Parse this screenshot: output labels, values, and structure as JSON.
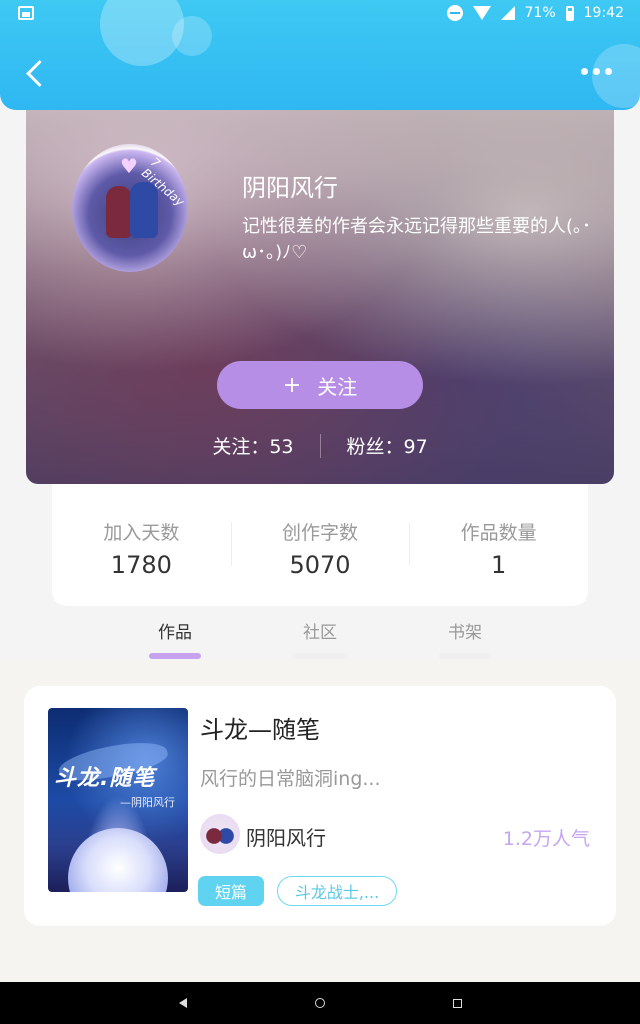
{
  "status_bar": {
    "battery": "71%",
    "time": "19:42"
  },
  "profile": {
    "name": "阴阳风行",
    "bio": "记性很差的作者会永远记得那些重要的人(｡･ω･｡)ﾉ♡",
    "avatar_text": "7 Birthday",
    "follow_button": "关注",
    "follow_icon": "+",
    "following": "关注：53",
    "fans": "粉丝：97"
  },
  "stats": [
    {
      "label": "加入天数",
      "value": "1780"
    },
    {
      "label": "创作字数",
      "value": "5070"
    },
    {
      "label": "作品数量",
      "value": "1"
    }
  ],
  "tabs": [
    {
      "label": "作品",
      "active": true
    },
    {
      "label": "社区",
      "active": false
    },
    {
      "label": "书架",
      "active": false
    }
  ],
  "book": {
    "title": "斗龙—随笔",
    "description": "风行的日常脑洞ing...",
    "author": "阴阳风行",
    "popularity": "1.2万人气",
    "cover_title": "斗龙.随笔",
    "cover_author": "—阴阳风行",
    "tags": [
      "短篇",
      "斗龙战士,..."
    ]
  },
  "colors": {
    "header": "#2fb7f2",
    "follow_button": "#b68ee6",
    "tab_active": "#c7a3ef",
    "tag_short": "#5fd3ef",
    "popularity": "#c6a6ef"
  }
}
